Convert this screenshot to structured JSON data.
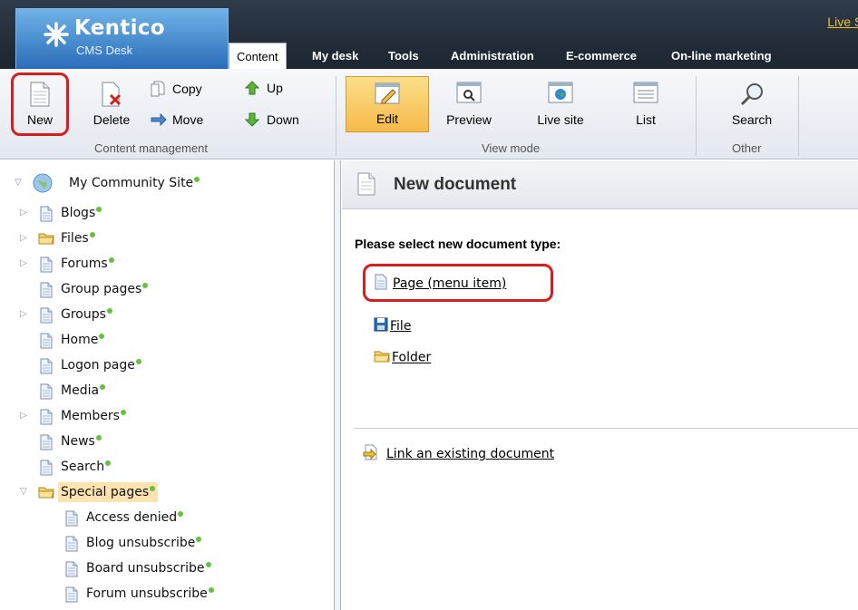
{
  "header": {
    "brand": "Kentico",
    "brand_sub": "CMS Desk",
    "live_site_link": "Live Site",
    "tabs": [
      "Content",
      "My desk",
      "Tools",
      "Administration",
      "E-commerce",
      "On-line marketing"
    ]
  },
  "ribbon": {
    "content_management": {
      "label": "Content management",
      "new": "New",
      "delete": "Delete",
      "copy": "Copy",
      "move": "Move",
      "up": "Up",
      "down": "Down"
    },
    "view_mode": {
      "label": "View mode",
      "edit": "Edit",
      "preview": "Preview",
      "live_site": "Live site",
      "list": "List"
    },
    "other": {
      "label": "Other",
      "search": "Search"
    }
  },
  "tree": {
    "root": "My Community Site",
    "items": [
      "Blogs",
      "Files",
      "Forums",
      "Group pages",
      "Groups",
      "Home",
      "Logon page",
      "Media",
      "Members",
      "News",
      "Search",
      "Special pages",
      "Access denied",
      "Blog unsubscribe",
      "Board unsubscribe",
      "Forum unsubscribe"
    ]
  },
  "main": {
    "title": "New document",
    "prompt": "Please select new document type:",
    "doc_types": [
      "Page (menu item)",
      "File",
      "Folder"
    ],
    "link_existing": "Link an existing document"
  },
  "colors": {
    "accent_red": "#d91c1c",
    "status_green": "#62c341",
    "top_bar": "#1c2530",
    "edit_active": "#f6b94a"
  }
}
